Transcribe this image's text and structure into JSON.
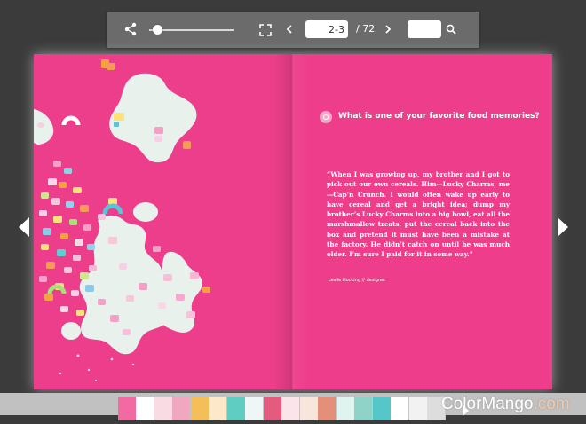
{
  "toolbar": {
    "page_value": "2-3",
    "page_total": "/ 72",
    "search_value": "",
    "zoom_level": 0.1
  },
  "spread": {
    "question": "What is one of your favorite food memories?",
    "quote": "“When I was growing up, my brother and I got to pick out our own cereals. Him—Lucky Charms, me—Cap’n Crunch. I would often wake up early to have cereal and get a bright idea; dump my brother’s Lucky Charms into a big bowl, eat all the marshmallow treats, put the cereal back into the box and pretend it must have been a mistake at the factory. He didn’t catch on until he was much older. I’m sure I paid for it in some way.”",
    "byline": "Leslie Hocking // designer"
  },
  "watermark": {
    "part1": "ColorMango",
    "part2": ".com"
  },
  "icons": {
    "share": "share-icon",
    "fullscreen": "fullscreen-icon",
    "prev": "chevron-left-icon",
    "next": "chevron-right-icon",
    "search": "search-icon",
    "nav_left": "arrow-left-icon",
    "nav_right": "arrow-right-icon"
  },
  "colors": {
    "page_pink": "#ec3e8a",
    "milk": "#e9f1ec",
    "toolbar": "#6b6b6b"
  },
  "thumbnails": [
    {
      "bg": "#f26aa0",
      "accent": "#ffffff"
    },
    {
      "bg": "#f9dbe3",
      "accent": "#f0a7bf"
    },
    {
      "bg": "#f4bf59",
      "accent": "#fde9ca"
    },
    {
      "bg": "#5fcdc1",
      "accent": "#eef7f5"
    },
    {
      "bg": "#e55a7f",
      "accent": "#fbe4ea"
    },
    {
      "bg": "#f8e6dd",
      "accent": "#e48f7a"
    },
    {
      "bg": "#dff3ef",
      "accent": "#8fd2c8"
    },
    {
      "bg": "#56c7c9",
      "accent": "#ffffff"
    },
    {
      "bg": "#f2f2f2",
      "accent": "#dddddd"
    }
  ]
}
